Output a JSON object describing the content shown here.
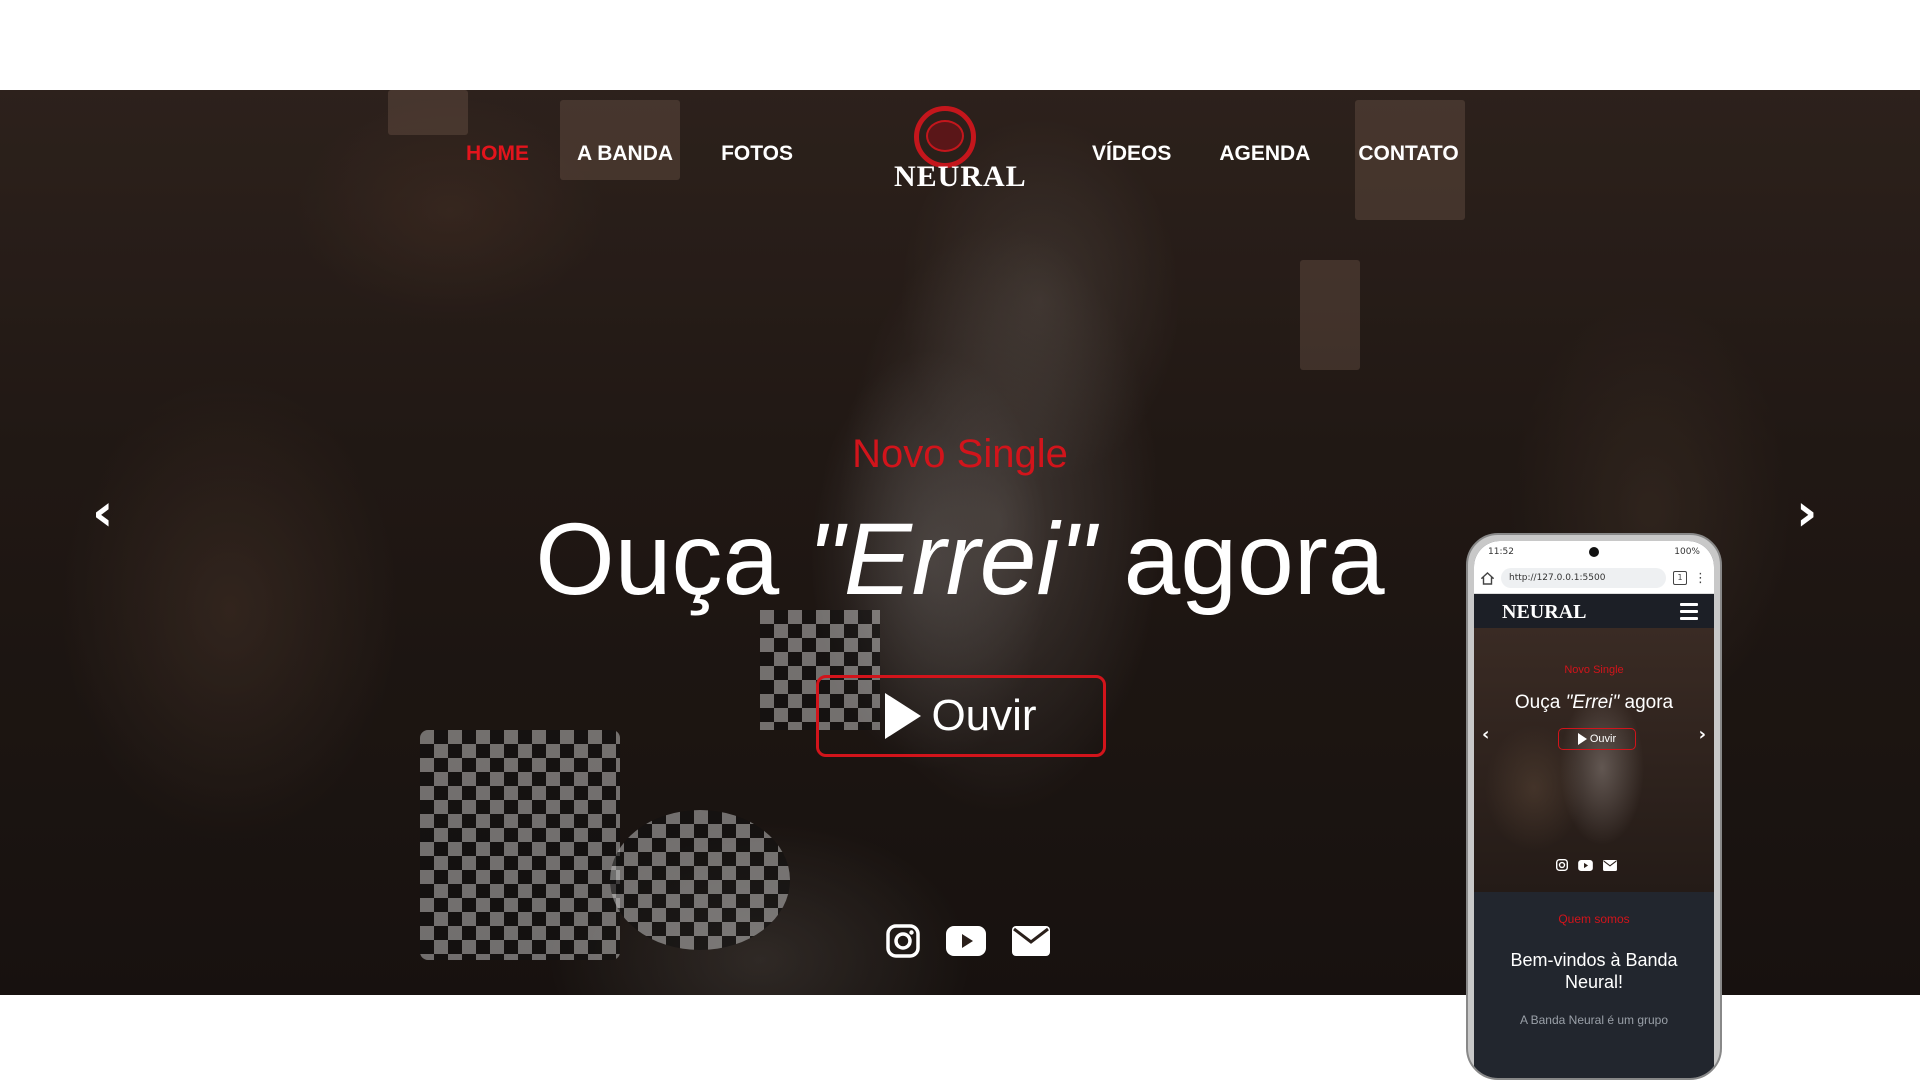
{
  "nav": {
    "left": [
      "HOME",
      "A BANDA",
      "FOTOS"
    ],
    "right": [
      "VÍDEOS",
      "AGENDA",
      "CONTATO"
    ],
    "active": "HOME"
  },
  "logo": {
    "text": "NEURAL"
  },
  "hero": {
    "subtitle": "Novo Single",
    "headline_pre": "Ouça ",
    "headline_em": "\"Errei\"",
    "headline_post": " agora",
    "button_label": "Ouvir",
    "arrow_prev": "‹",
    "arrow_next": "›",
    "social_icons": [
      "instagram-icon",
      "youtube-icon",
      "email-icon"
    ]
  },
  "colors": {
    "accent": "#d2141b",
    "nav_active": "#e3141c",
    "text": "#ffffff"
  },
  "mobile": {
    "status_time": "11:52",
    "status_battery": "100%",
    "url": "http://127.0.0.1:5500",
    "tabs_count": "1",
    "logo": "NEURAL",
    "hero_subtitle": "Novo Single",
    "hero_headline_pre": "Ouça ",
    "hero_headline_em": "\"Errei\"",
    "hero_headline_post": " agora",
    "button_label": "Ouvir",
    "about_label": "Quem somos",
    "about_title": "Bem-vindos à Banda Neural!",
    "about_text": "A Banda Neural é um grupo"
  }
}
